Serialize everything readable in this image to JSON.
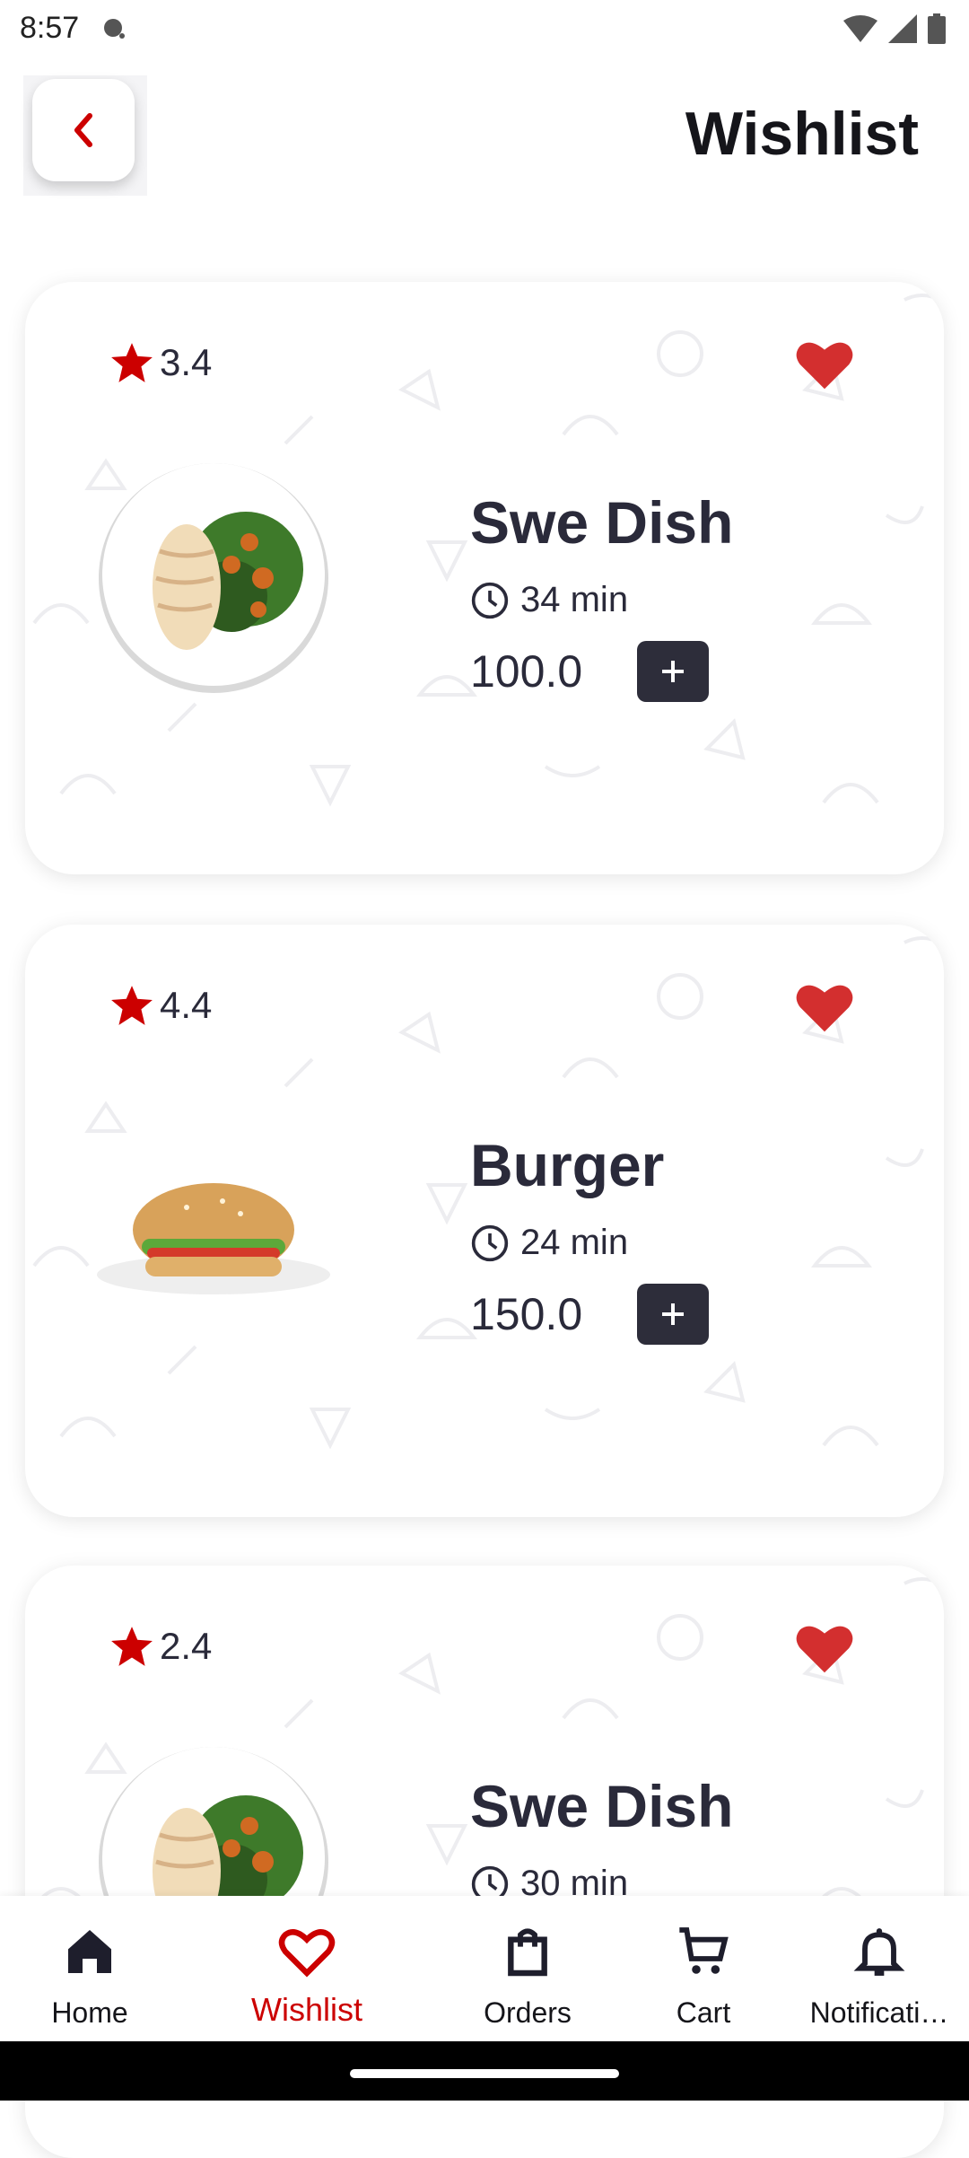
{
  "status_bar": {
    "time": "8:57"
  },
  "header": {
    "title": "Wishlist"
  },
  "items": [
    {
      "rating": "3.4",
      "name": "Swe Dish",
      "time": "34 min",
      "price": "100.0",
      "image": "salad-chicken-plate"
    },
    {
      "rating": "4.4",
      "name": "Burger",
      "time": "24 min",
      "price": "150.0",
      "image": "burger"
    },
    {
      "rating": "2.4",
      "name": "Swe Dish",
      "time": "30 min",
      "price": "",
      "image": "salad-chicken-plate"
    }
  ],
  "bottom_nav": [
    {
      "label": "Home",
      "icon": "home-icon"
    },
    {
      "label": "Wishlist",
      "icon": "heart-outline-icon",
      "active": true
    },
    {
      "label": "Orders",
      "icon": "shopping-bag-icon"
    },
    {
      "label": "Cart",
      "icon": "cart-icon"
    },
    {
      "label": "Notificati…",
      "icon": "bell-icon"
    }
  ],
  "colors": {
    "accent": "#cc0000",
    "dark": "#2d2d3a",
    "text": "#2a2a3a"
  }
}
